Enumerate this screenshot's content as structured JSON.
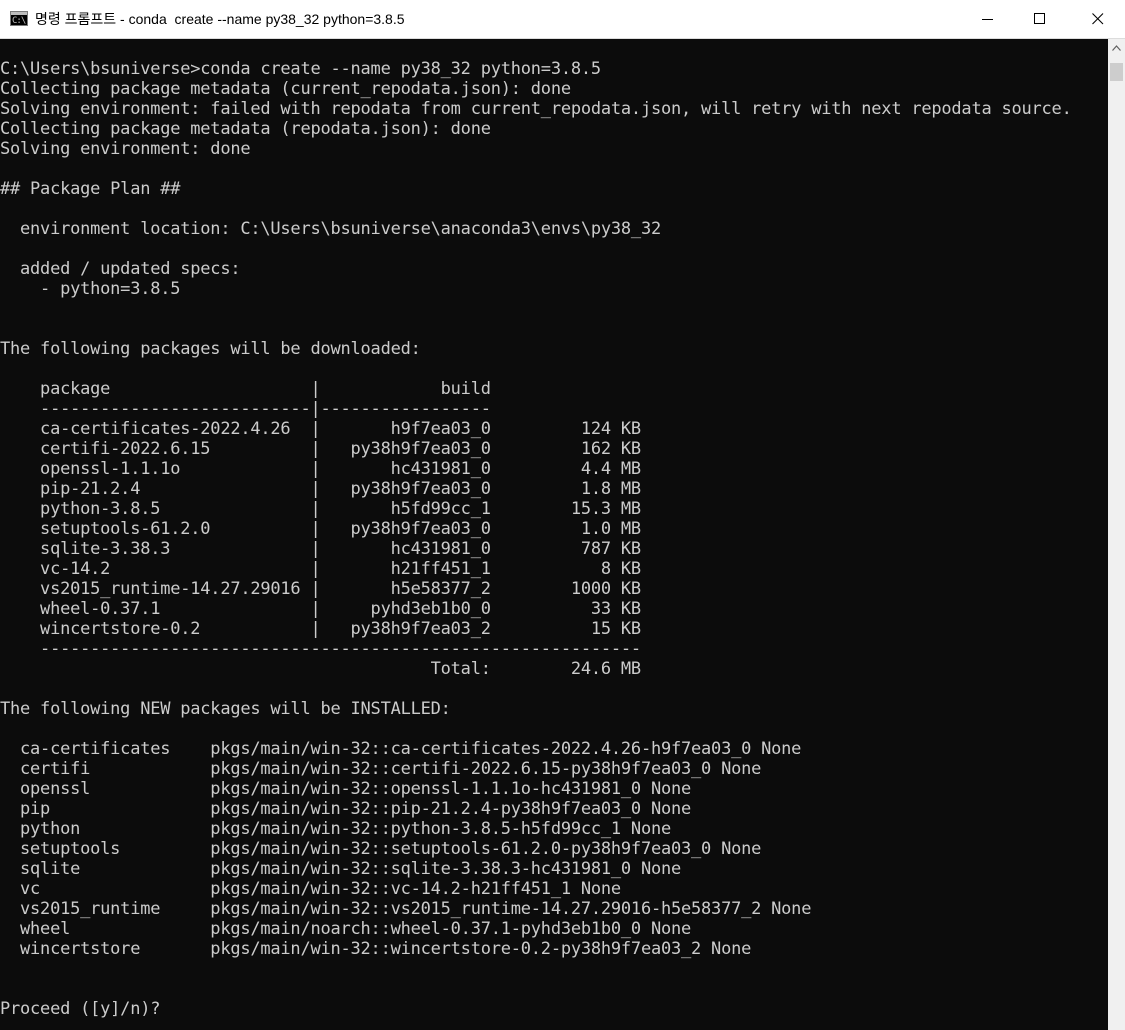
{
  "window": {
    "title": "명령 프롬프트 - conda  create --name py38_32 python=3.8.5",
    "icon": "cmd-icon",
    "icon_glyph": "C:\\"
  },
  "controls": {
    "minimize": "minimize-icon",
    "maximize": "maximize-icon",
    "close": "close-icon"
  },
  "console": {
    "lines": [
      "C:\\Users\\bsuniverse>conda create --name py38_32 python=3.8.5",
      "Collecting package metadata (current_repodata.json): done",
      "Solving environment: failed with repodata from current_repodata.json, will retry with next repodata source.",
      "Collecting package metadata (repodata.json): done",
      "Solving environment: done",
      "",
      "## Package Plan ##",
      "",
      "  environment location: C:\\Users\\bsuniverse\\anaconda3\\envs\\py38_32",
      "",
      "  added / updated specs:",
      "    - python=3.8.5",
      "",
      "",
      "The following packages will be downloaded:",
      "",
      "    package                    |            build",
      "    ---------------------------|-----------------",
      "    ca-certificates-2022.4.26  |       h9f7ea03_0         124 KB",
      "    certifi-2022.6.15          |   py38h9f7ea03_0         162 KB",
      "    openssl-1.1.1o             |       hc431981_0         4.4 MB",
      "    pip-21.2.4                 |   py38h9f7ea03_0         1.8 MB",
      "    python-3.8.5               |       h5fd99cc_1        15.3 MB",
      "    setuptools-61.2.0          |   py38h9f7ea03_0         1.0 MB",
      "    sqlite-3.38.3              |       hc431981_0         787 KB",
      "    vc-14.2                    |       h21ff451_1           8 KB",
      "    vs2015_runtime-14.27.29016 |       h5e58377_2        1000 KB",
      "    wheel-0.37.1               |     pyhd3eb1b0_0          33 KB",
      "    wincertstore-0.2           |   py38h9f7ea03_2          15 KB",
      "    ------------------------------------------------------------",
      "                                           Total:        24.6 MB",
      "",
      "The following NEW packages will be INSTALLED:",
      "",
      "  ca-certificates    pkgs/main/win-32::ca-certificates-2022.4.26-h9f7ea03_0 None",
      "  certifi            pkgs/main/win-32::certifi-2022.6.15-py38h9f7ea03_0 None",
      "  openssl            pkgs/main/win-32::openssl-1.1.1o-hc431981_0 None",
      "  pip                pkgs/main/win-32::pip-21.2.4-py38h9f7ea03_0 None",
      "  python             pkgs/main/win-32::python-3.8.5-h5fd99cc_1 None",
      "  setuptools         pkgs/main/win-32::setuptools-61.2.0-py38h9f7ea03_0 None",
      "  sqlite             pkgs/main/win-32::sqlite-3.38.3-hc431981_0 None",
      "  vc                 pkgs/main/win-32::vc-14.2-h21ff451_1 None",
      "  vs2015_runtime     pkgs/main/win-32::vs2015_runtime-14.27.29016-h5e58377_2 None",
      "  wheel              pkgs/main/noarch::wheel-0.37.1-pyhd3eb1b0_0 None",
      "  wincertstore       pkgs/main/win-32::wincertstore-0.2-py38h9f7ea03_2 None",
      "",
      "",
      "Proceed ([y]/n)?"
    ]
  },
  "scrollbar": {
    "up_arrow": "chevron-up-icon"
  }
}
